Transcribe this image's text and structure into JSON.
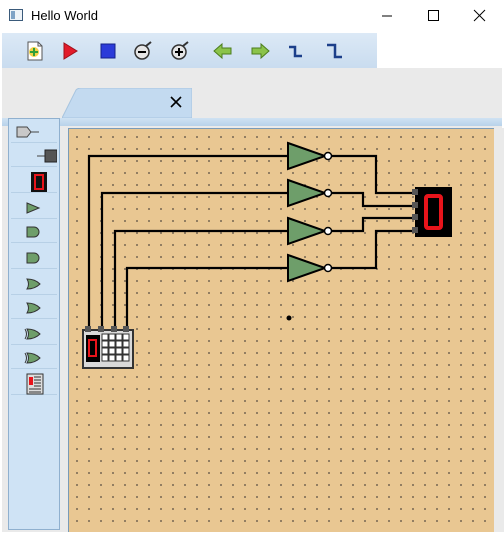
{
  "window": {
    "title": "Hello World"
  },
  "toolbar": {
    "buttons": [
      {
        "name": "new-icon"
      },
      {
        "name": "run-icon"
      },
      {
        "name": "stop-icon"
      },
      {
        "name": "zoom-out-icon"
      },
      {
        "name": "zoom-in-icon"
      },
      {
        "name": "back-icon"
      },
      {
        "name": "forward-icon"
      },
      {
        "name": "undo-icon"
      },
      {
        "name": "redo-icon"
      }
    ]
  },
  "tab": {
    "close_icon": "close-icon"
  },
  "palette": {
    "items": [
      "input-pin-icon",
      "output-pin-icon",
      "seven-segment-display-icon",
      "buffer-gate-icon",
      "and-gate-icon",
      "and-gate-icon",
      "or-gate-icon",
      "or-gate-icon",
      "xor-gate-icon",
      "xor-gate-icon",
      "keypad-icon"
    ]
  },
  "circuit": {
    "display_value": "0",
    "keypad_display_value": "0",
    "gate_type": "inverter",
    "gate_count": 4,
    "colors": {
      "wire": "#000000",
      "gate_fill": "#6e9e6a",
      "display_bg": "#000000",
      "segment_on": "#e8141b",
      "canvas": "#e9c792"
    }
  }
}
